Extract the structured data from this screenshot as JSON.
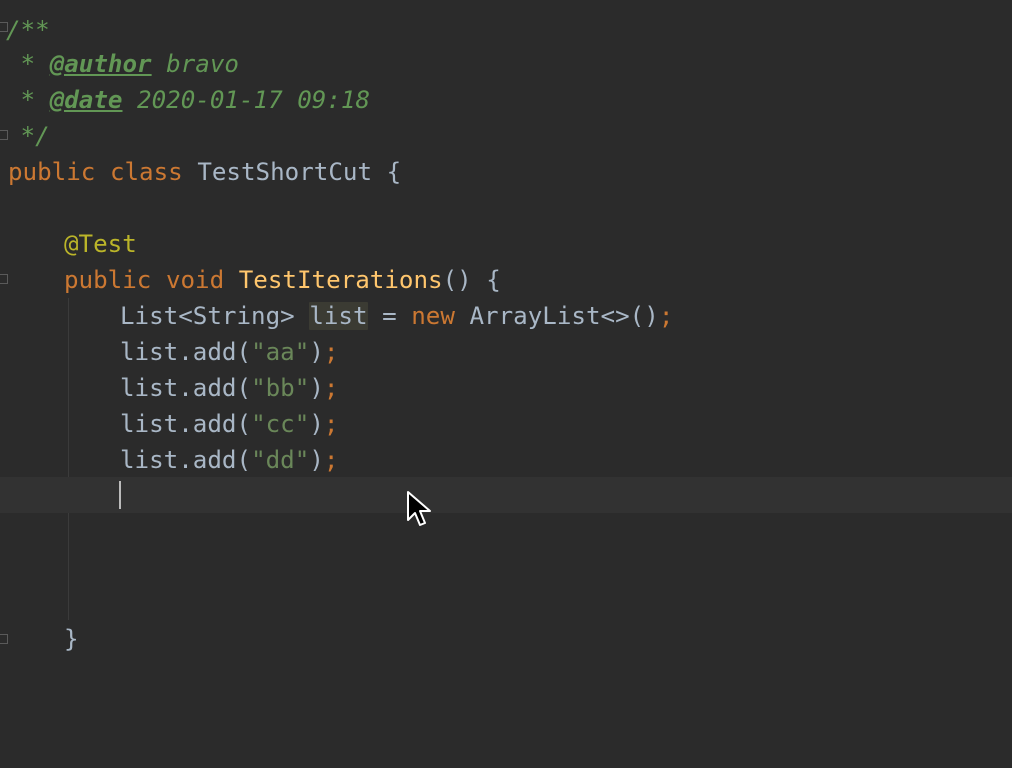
{
  "editor": {
    "doc_open": "/**",
    "doc_star_1": " * ",
    "doc_author_tag": "@author",
    "doc_author_value": " bravo",
    "doc_star_2": " * ",
    "doc_date_tag": "@date",
    "doc_date_value": " 2020-01-17 09:18",
    "doc_close": " */",
    "class_kw_public": "public",
    "class_kw_class": "class",
    "class_name": "TestShortCut",
    "class_open_brace": "{",
    "annotation": "@Test",
    "method_kw_public": "public",
    "method_kw_void": "void",
    "method_name": "TestIterations",
    "method_params": "() {",
    "decl_type": "List<String> ",
    "decl_var": "list",
    "decl_eq": " = ",
    "decl_new": "new",
    "decl_ctor": " ArrayList<>()",
    "semi": ";",
    "add_prefix": "list.add(",
    "add_suffix": ")",
    "add_args": [
      "\"aa\"",
      "\"bb\"",
      "\"cc\"",
      "\"dd\""
    ],
    "method_close_brace": "}"
  },
  "colors": {
    "background": "#2b2b2b",
    "current_line": "#323232",
    "keyword": "#cc7832",
    "annotation": "#bbb529",
    "method": "#ffc66d",
    "string": "#6a8759",
    "doc_comment": "#629755",
    "default_text": "#a9b7c6"
  }
}
